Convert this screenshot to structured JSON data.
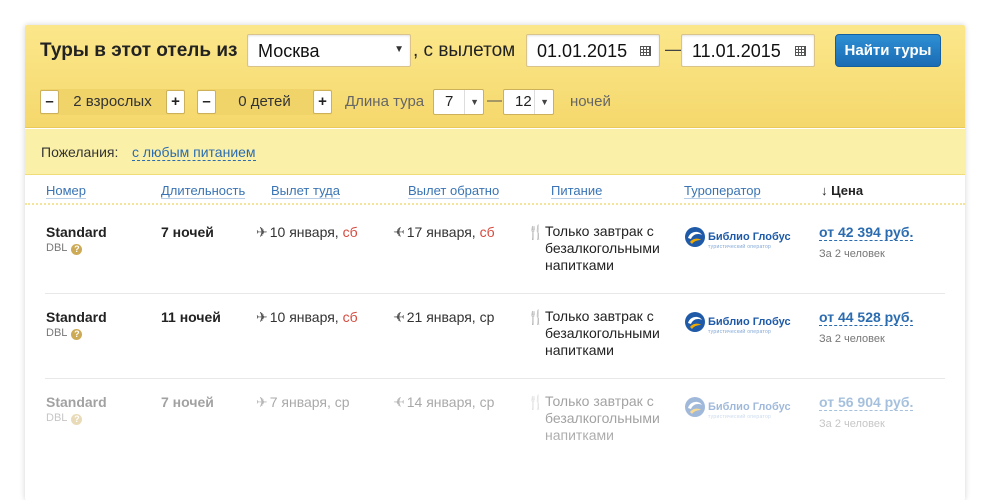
{
  "search": {
    "title": "Туры в этот отель из",
    "city": "Москва",
    "departure_label": ", с вылетом",
    "date_from": "01.01.2015",
    "date_to": "11.01.2015",
    "date_dash": "—",
    "find_button": "Найти туры",
    "adults": "2 взрослых",
    "children": "0 детей",
    "minus": "–",
    "plus": "+",
    "length_label": "Длина тура",
    "length_from": "7",
    "length_to": "12",
    "length_dash": "—",
    "nights_label": "ночей"
  },
  "wishes": {
    "label": "Пожелания:",
    "value": "с любым питанием"
  },
  "table": {
    "headers": {
      "room": "Номер",
      "duration": "Длительность",
      "depart": "Вылет туда",
      "return": "Вылет обратно",
      "meal": "Питание",
      "operator": "Туроператор",
      "price": "↓ Цена"
    },
    "rows": [
      {
        "room": "Standard",
        "room_type": "DBL",
        "duration": "7 ночей",
        "depart_date": "10 января,",
        "depart_wd": "сб",
        "depart_weekend": true,
        "return_date": "17 января,",
        "return_wd": "сб",
        "return_weekend": true,
        "meal": "Только завтрак с безалкогольными напитками",
        "operator": "Библио Глобус",
        "operator_sub": "туристический оператор",
        "price": "от 42 394 руб.",
        "price_sub": "За 2 человек"
      },
      {
        "room": "Standard",
        "room_type": "DBL",
        "duration": "11 ночей",
        "depart_date": "10 января,",
        "depart_wd": "сб",
        "depart_weekend": true,
        "return_date": "21 января,",
        "return_wd": "ср",
        "return_weekend": false,
        "meal": "Только завтрак с безалкогольными напитками",
        "operator": "Библио Глобус",
        "operator_sub": "туристический оператор",
        "price": "от 44 528 руб.",
        "price_sub": "За 2 человек"
      },
      {
        "room": "Standard",
        "room_type": "DBL",
        "duration": "7 ночей",
        "depart_date": "7 января,",
        "depart_wd": "ср",
        "depart_weekend": false,
        "return_date": "14 января,",
        "return_wd": "ср",
        "return_weekend": false,
        "meal": "Только завтрак с безалкогольными напитками",
        "operator": "Библио Глобус",
        "operator_sub": "туристический оператор",
        "price": "от 56 904 руб.",
        "price_sub": "За 2 человек"
      }
    ]
  },
  "colors": {
    "panel_yellow": "#f5d86c",
    "wishes_yellow": "#fbf0a8",
    "link_blue": "#2b6cb0",
    "button_blue": "#1a6cb3",
    "weekend_red": "#d64a3e"
  }
}
